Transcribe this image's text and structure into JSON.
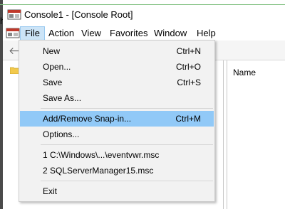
{
  "window": {
    "title": "Console1 - [Console Root]"
  },
  "edge_text": "h",
  "menubar": {
    "items": [
      {
        "label": "File"
      },
      {
        "label": "Action"
      },
      {
        "label": "View"
      },
      {
        "label": "Favorites"
      },
      {
        "label": "Window"
      },
      {
        "label": "Help"
      }
    ]
  },
  "file_menu": {
    "items": [
      {
        "label": "New",
        "shortcut": "Ctrl+N"
      },
      {
        "label": "Open...",
        "shortcut": "Ctrl+O"
      },
      {
        "label": "Save",
        "shortcut": "Ctrl+S"
      },
      {
        "label": "Save As...",
        "shortcut": ""
      },
      {
        "label": "Add/Remove Snap-in...",
        "shortcut": "Ctrl+M",
        "highlighted": true
      },
      {
        "label": "Options...",
        "shortcut": ""
      },
      {
        "label": "1 C:\\Windows\\...\\eventvwr.msc",
        "shortcut": ""
      },
      {
        "label": "2 SQLServerManager15.msc",
        "shortcut": ""
      },
      {
        "label": "Exit",
        "shortcut": ""
      }
    ]
  },
  "right_pane": {
    "column_header": "Name"
  },
  "colors": {
    "highlight": "#91c9f7",
    "menu_bg": "#f2f2f2",
    "active_menu": "#cce4f7"
  }
}
